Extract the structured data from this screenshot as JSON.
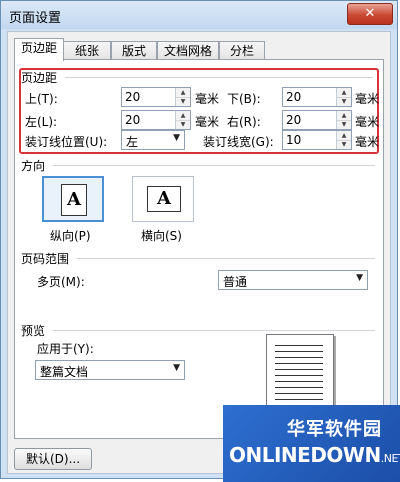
{
  "window": {
    "title": "页面设置",
    "close_glyph": "✕"
  },
  "tabs": [
    "页边距",
    "纸张",
    "版式",
    "文档网格",
    "分栏"
  ],
  "margins": {
    "section_title": "页边距",
    "top_label": "上(T):",
    "top_value": "20",
    "top_unit": "毫米",
    "bottom_label": "下(B):",
    "bottom_value": "20",
    "bottom_unit": "毫米",
    "left_label": "左(L):",
    "left_value": "20",
    "left_unit": "毫米",
    "right_label": "右(R):",
    "right_value": "20",
    "right_unit": "毫米",
    "gutter_pos_label": "装订线位置(U):",
    "gutter_pos_value": "左",
    "gutter_width_label": "装订线宽(G):",
    "gutter_width_value": "10",
    "gutter_width_unit": "毫米"
  },
  "orientation": {
    "section_title": "方向",
    "portrait_label": "纵向(P)",
    "landscape_label": "横向(S)",
    "glyph": "A"
  },
  "pages": {
    "section_title": "页码范围",
    "multiple_label": "多页(M):",
    "multiple_value": "普通"
  },
  "preview": {
    "section_title": "预览",
    "apply_label": "应用于(Y):",
    "apply_value": "整篇文档"
  },
  "buttons": {
    "default_label": "默认(D)..."
  },
  "watermark": {
    "cn": "华军软件园",
    "en": "ONLINEDOWN",
    "net": ".NET"
  }
}
